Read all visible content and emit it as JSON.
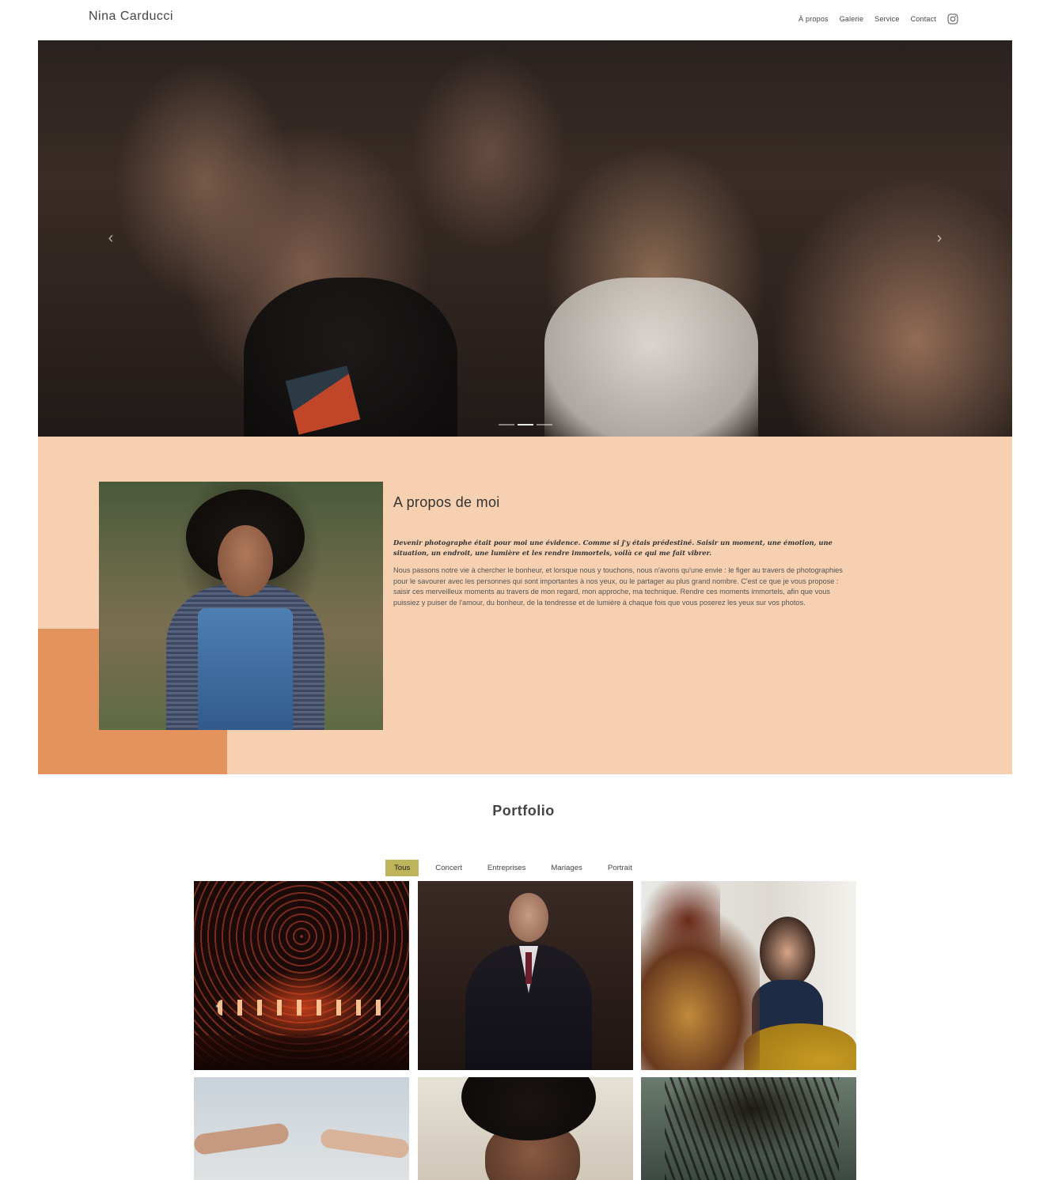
{
  "header": {
    "brand": "Nina Carducci",
    "nav": [
      "À propos",
      "Galerie",
      "Service",
      "Contact"
    ],
    "instagram_icon": "instagram-icon"
  },
  "carousel": {
    "prev_icon": "chevron-left-icon",
    "next_icon": "chevron-right-icon",
    "prev_glyph": "‹",
    "next_glyph": "›",
    "slide_count": 3,
    "active_slide": 2
  },
  "about": {
    "title": "A propos de moi",
    "lead": "Devenir photographe était pour moi une évidence. Comme si j'y étais prédestiné. Saisir un moment, une émotion, une situation, un endroit, une lumière et les rendre immortels, voilà ce qui me fait vibrer.",
    "body": "Nous passons notre vie à chercher le bonheur, et lorsque nous y touchons, nous n'avons qu'une envie : le figer au travers de photographies pour le savourer avec les personnes qui sont importantes à nos yeux, ou le partager au plus grand nombre. C'est ce que je vous propose : saisir ces merveilleux moments au travers de mon regard, mon approche, ma technique. Rendre ces moments immortels, afin que vous puissiez y puiser de l'amour, du bonheur, de la tendresse et de lumière à chaque fois que vous poserez les yeux sur vos photos.",
    "colors": {
      "background": "#f6d0b1",
      "accent": "#e4935d"
    }
  },
  "portfolio": {
    "title": "Portfolio",
    "filters": [
      "Tous",
      "Concert",
      "Entreprises",
      "Mariages",
      "Portrait"
    ],
    "active_filter": "Tous",
    "active_color": "#beb45b"
  }
}
